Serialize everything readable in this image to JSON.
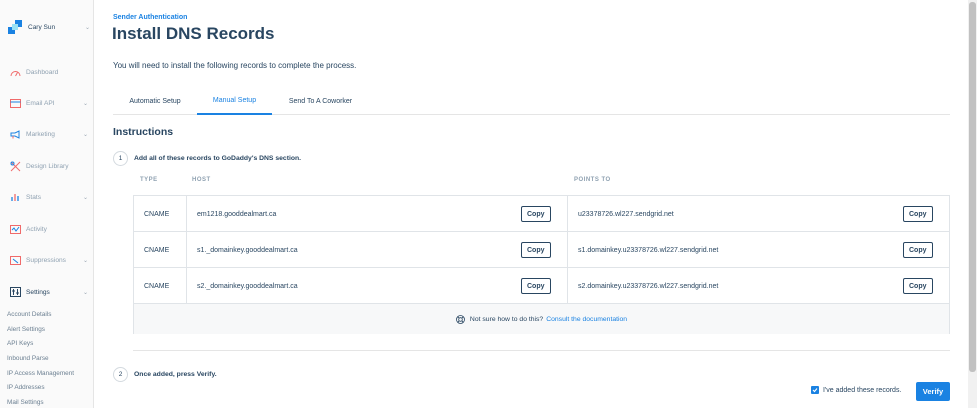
{
  "sidebar": {
    "account_name": "Cary Sun",
    "items": [
      {
        "label": "Dashboard",
        "icon": "dashboard-icon",
        "chevron": false
      },
      {
        "label": "Email API",
        "icon": "email-api-icon",
        "chevron": true
      },
      {
        "label": "Marketing",
        "icon": "megaphone-icon",
        "chevron": true
      },
      {
        "label": "Design Library",
        "icon": "design-library-icon",
        "chevron": false
      },
      {
        "label": "Stats",
        "icon": "stats-icon",
        "chevron": true
      },
      {
        "label": "Activity",
        "icon": "activity-icon",
        "chevron": false
      },
      {
        "label": "Suppressions",
        "icon": "suppressions-icon",
        "chevron": true
      },
      {
        "label": "Settings",
        "icon": "settings-icon",
        "chevron": true
      }
    ],
    "settings_sub": [
      "Account Details",
      "Alert Settings",
      "API Keys",
      "Inbound Parse",
      "IP Access Management",
      "IP Addresses",
      "Mail Settings"
    ]
  },
  "page": {
    "eyebrow": "Sender Authentication",
    "title": "Install DNS Records",
    "intro": "You will need to install the following records to complete the process."
  },
  "tabs": [
    {
      "label": "Automatic Setup",
      "active": false
    },
    {
      "label": "Manual Setup",
      "active": true
    },
    {
      "label": "Send To A Coworker",
      "active": false
    }
  ],
  "instructions": {
    "title": "Instructions",
    "step1": {
      "num": "1",
      "text": "Add all of these records to GoDaddy's DNS section."
    },
    "step2": {
      "num": "2",
      "text": "Once added, press Verify."
    }
  },
  "table": {
    "headers": {
      "type": "TYPE",
      "host": "HOST",
      "points_to": "POINTS TO"
    },
    "copy_label": "Copy",
    "rows": [
      {
        "type": "CNAME",
        "host": "em1218.gooddealmart.ca",
        "points_to": "u23378726.wl227.sendgrid.net"
      },
      {
        "type": "CNAME",
        "host": "s1._domainkey.gooddealmart.ca",
        "points_to": "s1.domainkey.u23378726.wl227.sendgrid.net"
      },
      {
        "type": "CNAME",
        "host": "s2._domainkey.gooddealmart.ca",
        "points_to": "s2.domainkey.u23378726.wl227.sendgrid.net"
      }
    ],
    "help_text": "Not sure how to do this?",
    "help_link": "Consult the documentation"
  },
  "confirm": {
    "checkbox_label": "I've added these records.",
    "checked": true,
    "verify_label": "Verify"
  },
  "colors": {
    "accent": "#1a82e2",
    "text": "#294661",
    "muted": "#8fa1b1"
  }
}
